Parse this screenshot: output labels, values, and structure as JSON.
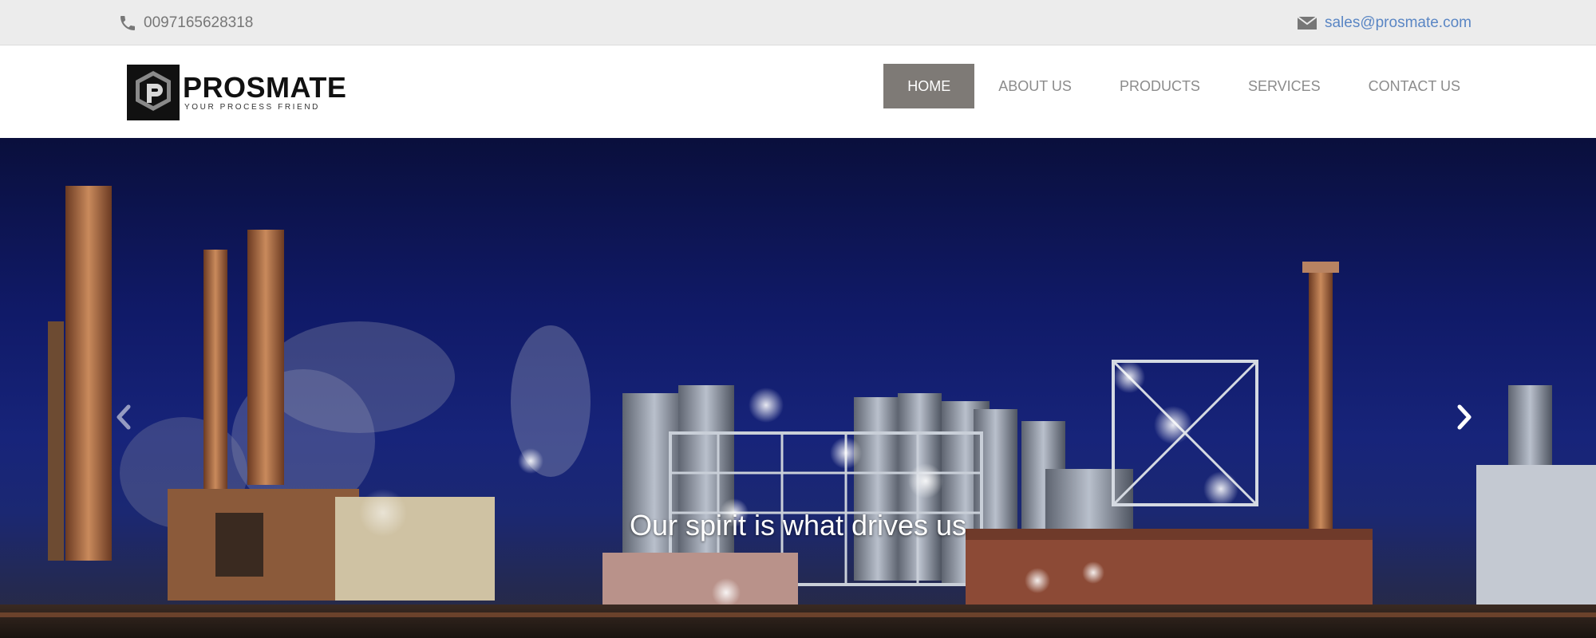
{
  "topbar": {
    "phone": "0097165628318",
    "email": "sales@prosmate.com"
  },
  "logo": {
    "name": "PROSMATE",
    "tagline": "YOUR PROCESS FRIEND",
    "mark_letter": "P"
  },
  "nav": {
    "items": [
      {
        "label": "HOME",
        "active": true
      },
      {
        "label": "ABOUT US",
        "active": false
      },
      {
        "label": "PRODUCTS",
        "active": false
      },
      {
        "label": "SERVICES",
        "active": false
      },
      {
        "label": "CONTACT US",
        "active": false
      }
    ]
  },
  "hero": {
    "caption": "Our spirit is what drives us",
    "prev_icon": "chevron-left-icon",
    "next_icon": "chevron-right-icon"
  },
  "colors": {
    "topbar_bg": "#ececec",
    "nav_active_bg": "#7e7a76",
    "nav_text": "#8c8c8c",
    "email_link": "#5a86c4"
  }
}
